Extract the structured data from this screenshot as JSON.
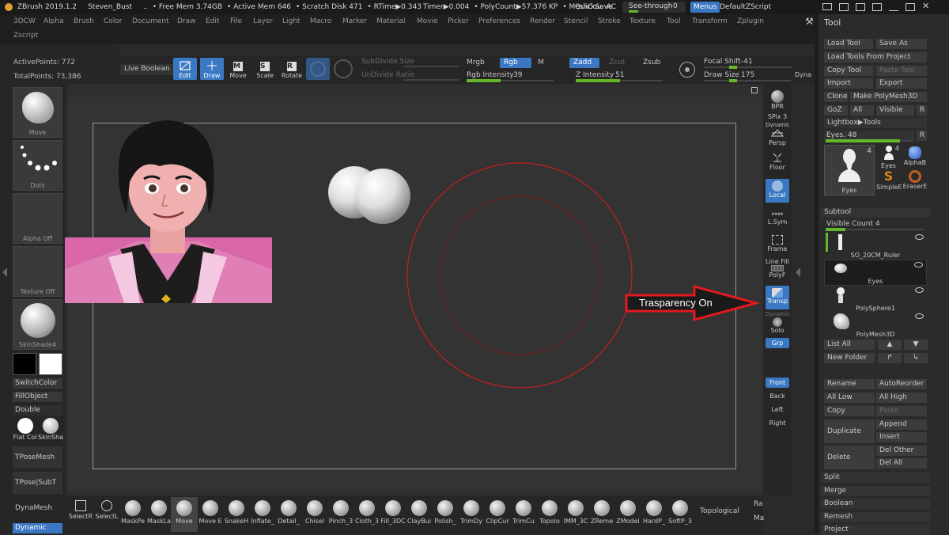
{
  "titlebar": {
    "app": "ZBrush 2019.1.2",
    "project": "Steven_Bust",
    "dots": "..",
    "free_mem": "• Free Mem 3.74GB",
    "active_mem": "• Active Mem 646",
    "scratch": "• Scratch Disk 471",
    "rtime": "• RTime▶0.343",
    "timer": "Timer▶0.004",
    "polycount": "• PolyCount▶57.376 KP",
    "meshcount": "• MeshCou",
    "ac": "AC",
    "quicksave": "QuickSave",
    "see_through": "See-through",
    "see_through_val": "0",
    "menus": "Menus",
    "script": "DefaultZScript",
    "see_through_level": 0
  },
  "menubar": {
    "items": [
      "3DCW",
      "Alpha",
      "Brush",
      "Color",
      "Document",
      "Draw",
      "Edit",
      "File",
      "Layer",
      "Light",
      "Macro",
      "Marker",
      "Material",
      "Movie",
      "Picker",
      "Preferences",
      "Render",
      "Stencil",
      "Stroke",
      "Texture",
      "Tool",
      "Transform",
      "Zplugin"
    ],
    "zscript": "Zscript"
  },
  "info": {
    "active_points": "ActivePoints: 772",
    "total_points": "TotalPoints: 73,386"
  },
  "toolbar": {
    "live_boolean": "Live Boolean",
    "edit": "Edit",
    "draw": "Draw",
    "move": "Move",
    "scale": "Scale",
    "rotate": "Rotate",
    "subdivide_size": "SubDivide Size",
    "undivide_ratio": "UnDivide Ratio",
    "mrgb": "Mrgb",
    "rgb": "Rgb",
    "m": "M",
    "zadd": "Zadd",
    "zcut": "Zcut",
    "zsub": "Zsub",
    "rgb_intensity": "Rgb Intensity",
    "rgb_intensity_val": "39",
    "rgb_intensity_level": 0.39,
    "z_intensity": "Z Intensity",
    "z_intensity_val": "51",
    "z_intensity_level": 0.51,
    "focal_shift": "Focal Shift",
    "focal_shift_val": "-41",
    "draw_size": "Draw Size",
    "draw_size_val": "175",
    "dyna": "Dyna",
    "icon_m": "M",
    "icon_s": "S",
    "icon_r": "R"
  },
  "leftshelf": {
    "brush": "Move",
    "stroke": "Dots",
    "alpha": "Alpha Off",
    "texture": "Texture Off",
    "material": "SkinShade4",
    "switch_color": "SwitchColor",
    "fill_object": "FillObject",
    "double": "Double",
    "flat_color": "Flat Col",
    "skin_sha": "SkinSha",
    "tpose_mesh": "TPoseMesh",
    "tpose_subt": "TPose|SubT",
    "dynamesh": "DynaMesh",
    "dynamic": "Dynamic"
  },
  "rightshelf": {
    "bpr": "BPR",
    "spix": "SPix 3",
    "dynamic": "Dynamic",
    "persp": "Persp",
    "floor": "Floor",
    "local": "Local",
    "lsym": "L.Sym",
    "frame": "Frame",
    "line_fill": "Line Fill",
    "polyf": "PolyF",
    "transp": "Transp",
    "dynamic2": "Dynamic",
    "solo": "Solo",
    "grp": "Grp",
    "front": "Front",
    "back": "Back",
    "left": "Left",
    "right": "Right"
  },
  "annotation": {
    "label": "Trasparency On",
    "color": "#e0191f"
  },
  "bottomshelf": {
    "items": [
      "SelectR",
      "SelectL",
      "MaskPe",
      "MaskLa",
      "Move",
      "Move E",
      "SnakeH",
      "Inflate_",
      "Detail_",
      "Chisel",
      "Pinch_3",
      "Cloth_3",
      "Fill_3DC",
      "ClayBui",
      "Polish_",
      "TrimDy",
      "ClipCur",
      "TrimCu",
      "Topolo",
      "IMM_3C",
      "ZReme",
      "ZModel",
      "HardP_",
      "SoftP_3"
    ],
    "topological": "Topological",
    "ra": "Ra",
    "ma": "Ma"
  },
  "toolpanel": {
    "title": "Tool",
    "load_tool": "Load Tool",
    "save_as": "Save As",
    "load_from_project": "Load Tools From Project",
    "copy_tool": "Copy Tool",
    "paste_tool": "Paste Tool",
    "import": "Import",
    "export": "Export",
    "clone": "Clone",
    "make_polymesh": "Make PolyMesh3D",
    "goz": "GoZ",
    "all": "All",
    "visible": "Visible",
    "r": "R",
    "lightbox_tools": "Lightbox▶Tools",
    "eyes_slider": "Eyes. 48",
    "eyes_slider_level": 0.85,
    "thumb_eyes": "Eyes",
    "thumb_eyes_count": "4",
    "thumb_eyes2": "Eyes",
    "thumb_eyes2_count": "4",
    "thumb_alphab": "AlphaB",
    "thumb_simplee": "SimpleE",
    "thumb_erasere": "EraserE",
    "subtool": "Subtool",
    "visible_count": "Visible Count 4",
    "visible_count_level": 0.2,
    "subtools": [
      "SO_20CM_Ruler",
      "Eyes",
      "PolySphere1",
      "PolyMesh3D"
    ],
    "list_all": "List All",
    "new_folder": "New Folder",
    "rename": "Rename",
    "autoreorder": "AutoReorder",
    "all_low": "All Low",
    "all_high": "All High",
    "copy": "Copy",
    "paste": "Paste",
    "duplicate": "Duplicate",
    "append": "Append",
    "insert": "Insert",
    "delete": "Delete",
    "del_other": "Del Other",
    "del_all": "Del All",
    "split": "Split",
    "merge": "Merge",
    "boolean": "Boolean",
    "remesh": "Remesh",
    "project": "Project"
  },
  "colors": {
    "accent": "#3a78c4",
    "slider": "#66b82a",
    "annotation_red": "#e0191f"
  }
}
